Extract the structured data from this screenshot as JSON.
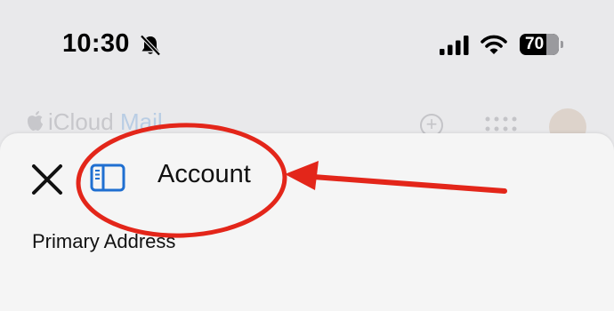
{
  "status_bar": {
    "time": "10:30",
    "battery": "70"
  },
  "background_app": {
    "title_prefix": "iCloud",
    "title_suffix": "Mail"
  },
  "sheet": {
    "title": "Account",
    "section_label": "Primary Address"
  },
  "colors": {
    "accent": "#1f6fd1",
    "annotation": "#e3261a",
    "sheet_background": "#f5f5f5"
  },
  "icons": [
    "bell-slash-icon",
    "signal-icon",
    "wifi-icon",
    "battery-icon",
    "apple-logo-icon",
    "plus-icon",
    "app-grid-icon",
    "avatar",
    "close-icon",
    "sidebar-icon"
  ]
}
